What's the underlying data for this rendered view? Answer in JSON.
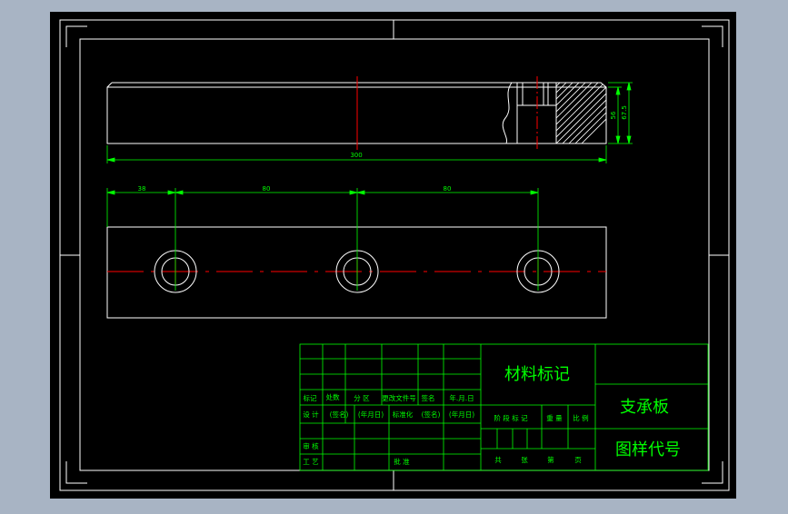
{
  "colors": {
    "background": "#a8b4c4",
    "sheet": "#000000",
    "frame": "#ffffff",
    "dimension": "#00ff00",
    "centerline": "#ff0000",
    "hatch": "#ffffff"
  },
  "dimensions": {
    "overall_length": "300",
    "height_total": "67.5",
    "height_step": "56",
    "hole_offset_1": "38",
    "hole_offset_2": "80",
    "hole_offset_3": "80"
  },
  "title_block": {
    "material_mark": "材料标记",
    "part_name": "支承板",
    "drawing_number": "图样代号",
    "row_labels": {
      "mark": "标记",
      "count": "处数",
      "zone": "分 区",
      "change_doc": "更改文件号",
      "signature": "签名",
      "date": "年.月.日",
      "design": "设 计",
      "sign_paren": "(签名)",
      "date_paren": "(年月日)",
      "standardize": "标准化",
      "sign_paren_2": "(签名)",
      "date_paren_2": "(年月日)",
      "review": "审 核",
      "process": "工 艺",
      "approve": "批 准"
    },
    "stage_labels": {
      "stage_mark": "阶 段 标 记",
      "weight": "重 量",
      "scale": "比 例"
    },
    "sheet_labels": {
      "total": "共",
      "sheets": "张",
      "page": "第",
      "page_unit": "页"
    }
  }
}
